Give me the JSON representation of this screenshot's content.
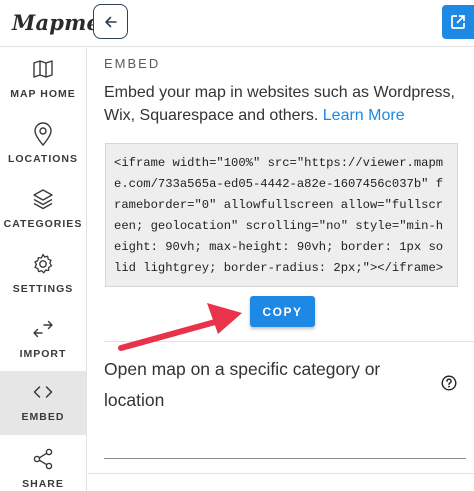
{
  "app": {
    "logo": "Mapme"
  },
  "sidebar": {
    "items": [
      {
        "label": "MAP HOME",
        "icon": "map-icon"
      },
      {
        "label": "LOCATIONS",
        "icon": "location-pin-icon"
      },
      {
        "label": "CATEGORIES",
        "icon": "layers-icon"
      },
      {
        "label": "SETTINGS",
        "icon": "gear-icon"
      },
      {
        "label": "IMPORT",
        "icon": "swap-arrows-icon"
      },
      {
        "label": "EMBED",
        "icon": "code-icon",
        "active": true
      },
      {
        "label": "SHARE",
        "icon": "share-icon"
      }
    ]
  },
  "embed": {
    "title": "EMBED",
    "description": "Embed your map in websites such as Wordpress, Wix, Squarespace and others. ",
    "learn_more": "Learn More",
    "code": "<iframe width=\"100%\" src=\"https://viewer.mapme.com/733a565a-ed05-4442-a82e-1607456c037b\" frameborder=\"0\" allowfullscreen allow=\"fullscreen; geolocation\" scrolling=\"no\" style=\"min-height: 90vh; max-height: 90vh; border: 1px solid lightgrey; border-radius: 2px;\"></iframe>",
    "copy_label": "COPY"
  },
  "specific": {
    "title": "Open map on a specific category or location"
  },
  "colors": {
    "accent": "#1e88e5",
    "arrow": "#e8334a",
    "active_nav": "#e6e6e6"
  }
}
